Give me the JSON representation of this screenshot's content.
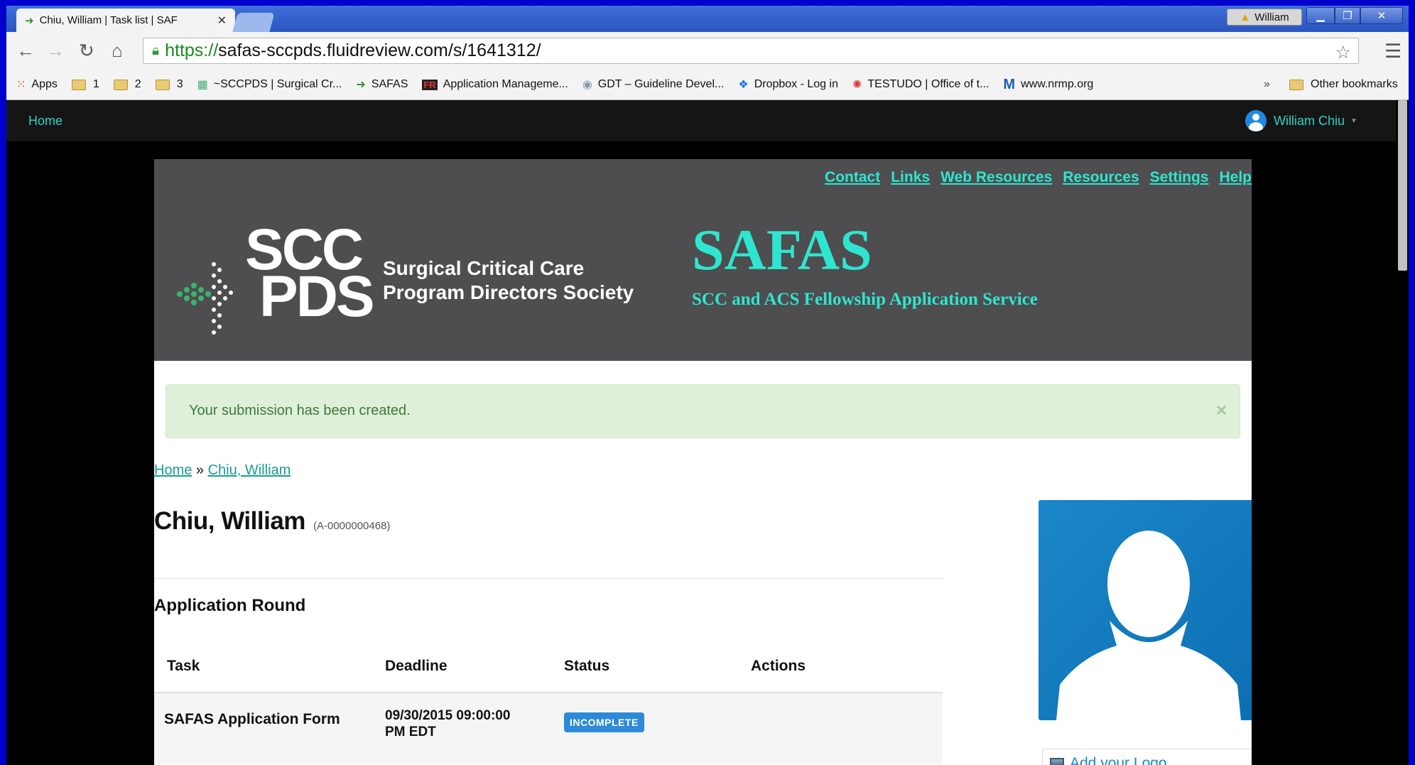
{
  "browser": {
    "tab_title": "Chiu, William | Task list | SAF",
    "profile_name": "William",
    "url_scheme": "https://",
    "url_rest": "safas-sccpds.fluidreview.com/s/1641312/",
    "bookmarks": [
      {
        "label": "Apps",
        "icon": "apps-grid-icon"
      },
      {
        "label": "1",
        "icon": "folder-icon"
      },
      {
        "label": "2",
        "icon": "folder-icon"
      },
      {
        "label": "3",
        "icon": "folder-icon"
      },
      {
        "label": "~SCCPDS | Surgical Cr...",
        "icon": "site-icon"
      },
      {
        "label": "SAFAS",
        "icon": "arrow-logo-icon"
      },
      {
        "label": "Application Manageme...",
        "icon": "fr-logo-icon"
      },
      {
        "label": "GDT – Guideline Devel...",
        "icon": "gdt-icon"
      },
      {
        "label": "Dropbox - Log in",
        "icon": "dropbox-icon"
      },
      {
        "label": "TESTUDO | Office of t...",
        "icon": "maryland-icon"
      },
      {
        "label": "www.nrmp.org",
        "icon": "m-logo-icon"
      }
    ],
    "more_label": "»",
    "other_bookmarks": "Other bookmarks"
  },
  "nav": {
    "home": "Home",
    "user": "William Chiu"
  },
  "banner": {
    "links": [
      "Contact",
      "Links",
      "Web Resources",
      "Resources",
      "Settings",
      "Help"
    ],
    "logo_scc": "SCC",
    "logo_pds": "PDS",
    "logo_line1": "Surgical Critical Care",
    "logo_line2": "Program Directors Society",
    "title": "SAFAS",
    "subtitle": "SCC and ACS Fellowship Application Service"
  },
  "alert": {
    "message": "Your submission has been created.",
    "close": "×"
  },
  "breadcrumb": {
    "home": "Home",
    "separator": "»",
    "current": "Chiu, William"
  },
  "page": {
    "title": "Chiu, William",
    "app_id": "(A-0000000468)",
    "section": "Application Round"
  },
  "table": {
    "headers": [
      "Task",
      "Deadline",
      "Status",
      "Actions"
    ],
    "rows": [
      {
        "task": "SAFAS Application Form",
        "deadline": "09/30/2015 09:00:00 PM EDT",
        "status": "INCOMPLETE",
        "actions": ""
      }
    ]
  },
  "sidebar": {
    "add_logo": "Add your Logo"
  },
  "colors": {
    "accent": "#2ee6cf",
    "banner_bg": "#4e4d4f",
    "status_badge": "#2e8ad8",
    "alert_bg": "#dff0d8"
  }
}
